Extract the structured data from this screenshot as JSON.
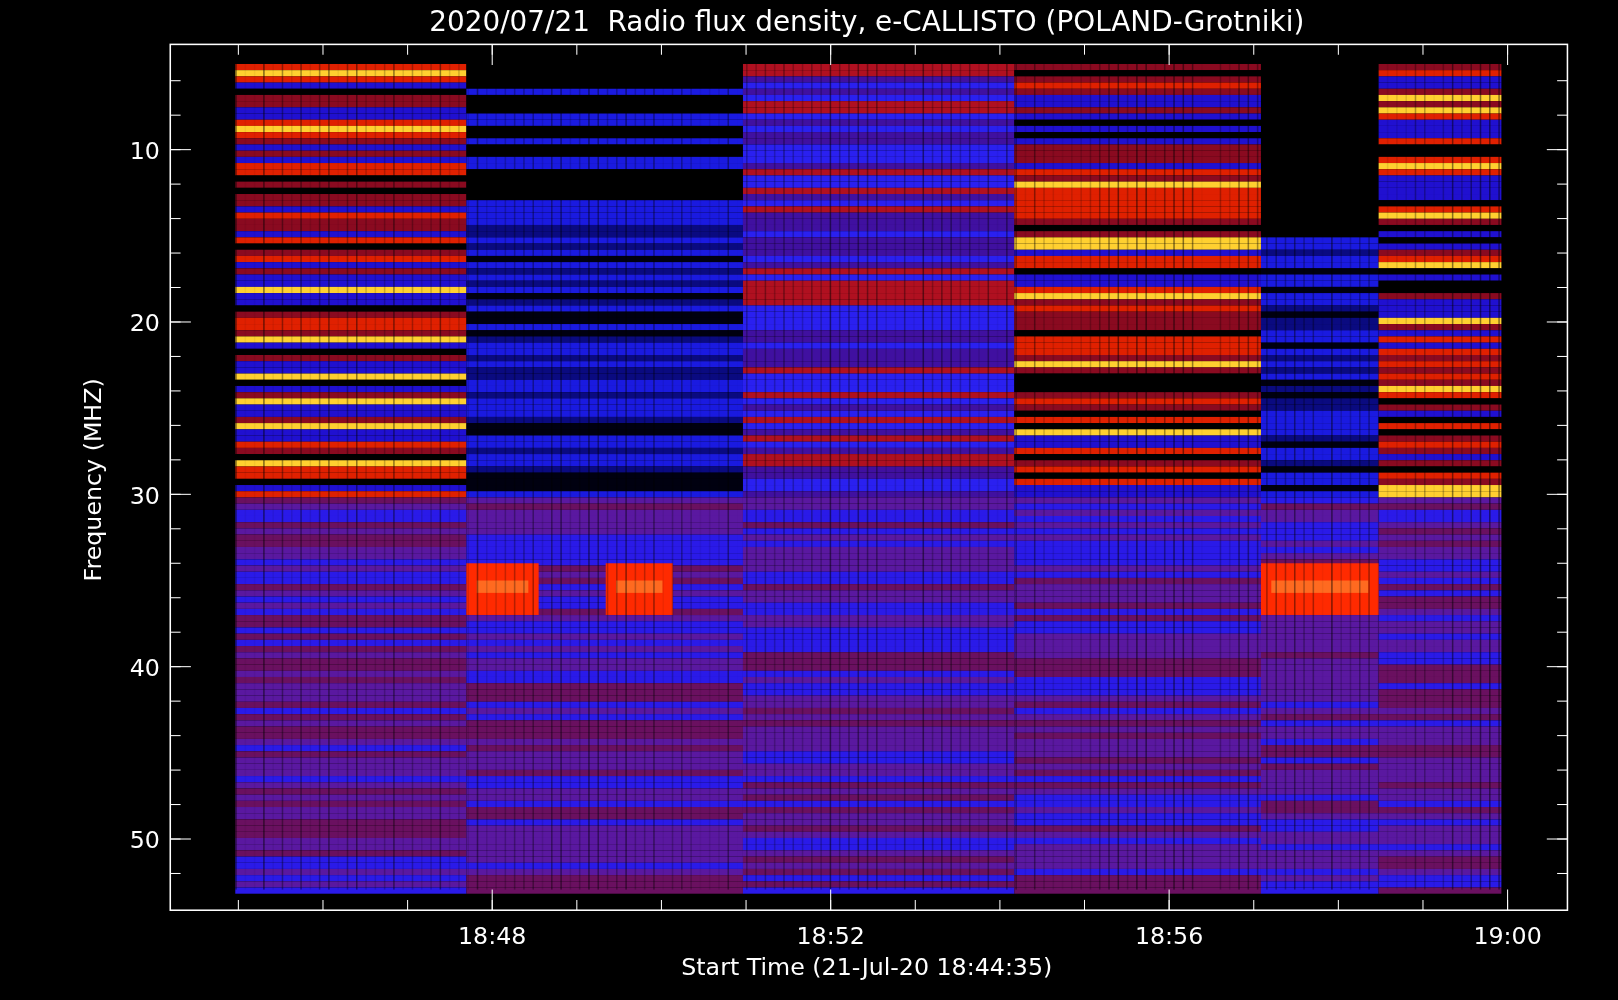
{
  "title": "2020/07/21  Radio flux density, e-CALLISTO (POLAND-Grotniki)",
  "ylabel": "Frequency (MHZ)",
  "xlabel": "Start Time (21-Jul-20 18:44:35)",
  "y_tick_labels": [
    "10",
    "20",
    "30",
    "40",
    "50"
  ],
  "x_tick_labels": [
    "18:48",
    "18:52",
    "18:56",
    "19:00"
  ]
}
